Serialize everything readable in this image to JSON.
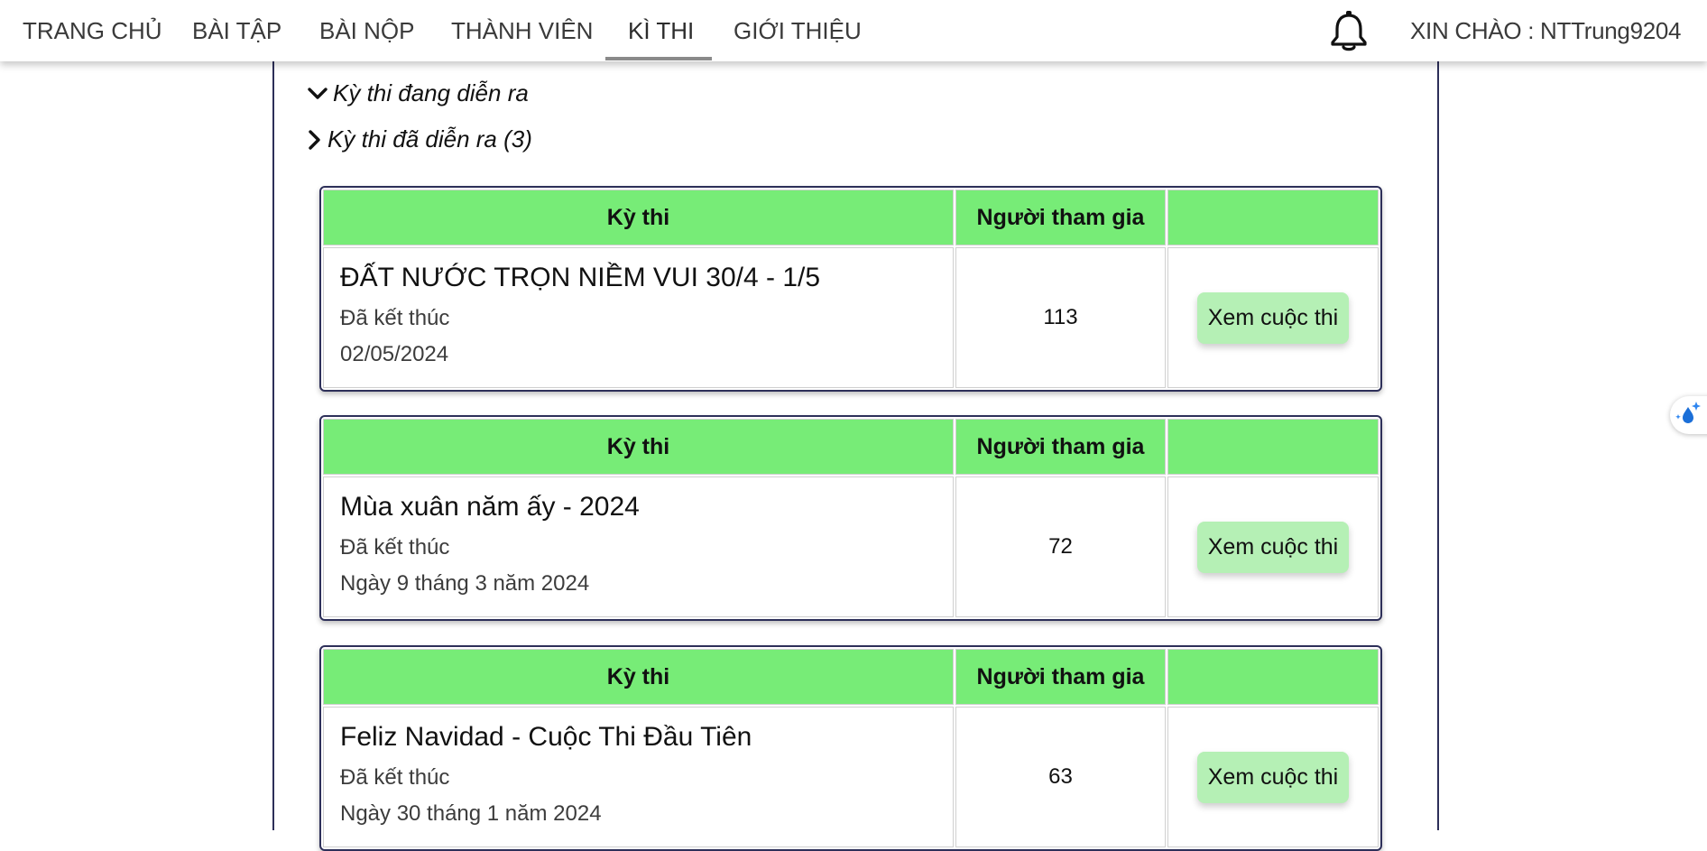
{
  "nav": {
    "items": [
      {
        "label": "TRANG CHỦ"
      },
      {
        "label": "BÀI TẬP"
      },
      {
        "label": "BÀI NỘP"
      },
      {
        "label": "THÀNH VIÊN"
      },
      {
        "label": "KÌ THI"
      },
      {
        "label": "GIỚI THIỆU"
      }
    ],
    "active_index": 4,
    "greeting": "XIN CHÀO : NTTrung9204",
    "bell_icon": "bell-icon"
  },
  "sections": {
    "ongoing": {
      "label": "Kỳ thi đang diễn ra",
      "expanded": true
    },
    "past": {
      "label": "Kỳ thi đã diễn ra (3)",
      "expanded": false
    }
  },
  "table_headers": {
    "contest": "Kỳ thi",
    "participants": "Người tham gia",
    "action": ""
  },
  "contests": [
    {
      "title": "ĐẤT NƯỚC TRỌN NIỀM VUI 30/4 - 1/5",
      "status": "Đã kết thúc",
      "date": "02/05/2024",
      "participants": "113",
      "button": "Xem cuộc thi"
    },
    {
      "title": "Mùa xuân năm ấy - 2024",
      "status": "Đã kết thúc",
      "date": "Ngày 9 tháng 3 năm 2024",
      "participants": "72",
      "button": "Xem cuộc thi"
    },
    {
      "title": "Feliz Navidad - Cuộc Thi Đầu Tiên",
      "status": "Đã kết thúc",
      "date": "Ngày 30 tháng 1 năm 2024",
      "participants": "63",
      "button": "Xem cuộc thi"
    }
  ],
  "colors": {
    "header_green": "#77ec77",
    "button_green": "#b5f0b5",
    "border_navy": "#2d2f59"
  },
  "side_widget_icon": "sparkle-drop-icon"
}
